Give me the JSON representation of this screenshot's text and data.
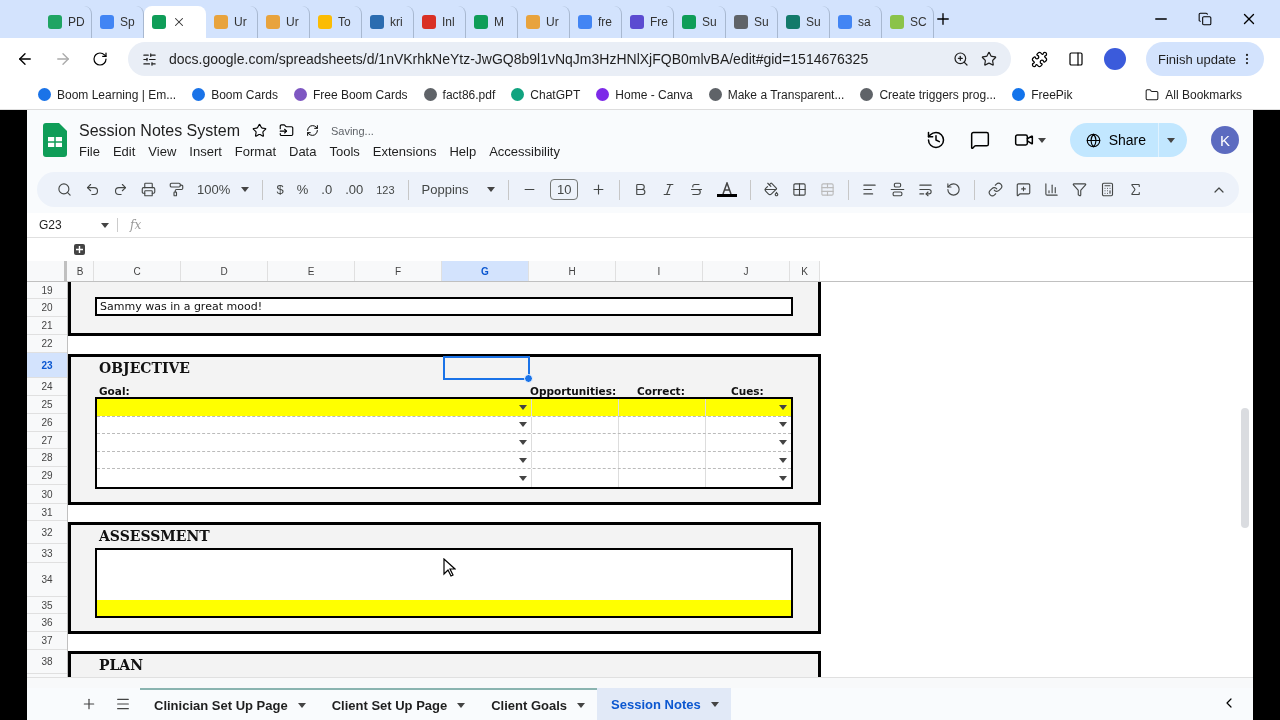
{
  "browser_tabs": [
    {
      "label": "PD",
      "color": "#1fa463",
      "selected": false
    },
    {
      "label": "Sp",
      "color": "#4285f4",
      "selected": false
    },
    {
      "color": "#0f9d58",
      "selected": true
    },
    {
      "label": "Ur",
      "color": "#e8a33d",
      "selected": false
    },
    {
      "label": "Ur",
      "color": "#e8a33d",
      "selected": false
    },
    {
      "label": "To",
      "color": "#fbbc04",
      "selected": false
    },
    {
      "label": "kri",
      "color": "#2b6cb0",
      "selected": false
    },
    {
      "label": "Inl",
      "color": "#d93025",
      "selected": false
    },
    {
      "label": "M",
      "color": "#0f9d58",
      "selected": false
    },
    {
      "label": "Ur",
      "color": "#e8a33d",
      "selected": false
    },
    {
      "label": "fre",
      "color": "#4285f4",
      "selected": false
    },
    {
      "label": "Fre",
      "color": "#5b4bd1",
      "selected": false
    },
    {
      "label": "Su",
      "color": "#0f9d58",
      "selected": false
    },
    {
      "label": "Su",
      "color": "#5f6368",
      "selected": false
    },
    {
      "label": "Su",
      "color": "#137a6b",
      "selected": false
    },
    {
      "label": "sa",
      "color": "#4285f4",
      "selected": false
    },
    {
      "label": "SC",
      "color": "#8bc34a",
      "selected": false
    }
  ],
  "address": {
    "url": "docs.google.com/spreadsheets/d/1nVKrhkNeYtz-JwGQ8b9l1vNqJm3HzHNlXjFQB0mlvBA/edit#gid=1514676325",
    "update_button": "Finish update"
  },
  "bookmarks": [
    {
      "label": "Boom Learning | Em...",
      "color": "#1a73e8"
    },
    {
      "label": "Boom Cards",
      "color": "#1a73e8"
    },
    {
      "label": "Free Boom Cards",
      "color": "#7e57c2"
    },
    {
      "label": "fact86.pdf",
      "color": "#5f6368"
    },
    {
      "label": "ChatGPT",
      "color": "#10a37f"
    },
    {
      "label": "Home - Canva",
      "color": "#7d2ae8"
    },
    {
      "label": "Make a Transparent...",
      "color": "#5f6368"
    },
    {
      "label": "Create triggers prog...",
      "color": "#5f6368"
    },
    {
      "label": "FreePik",
      "color": "#1273eb"
    }
  ],
  "all_bookmarks": "All Bookmarks",
  "document": {
    "title": "Session Notes System",
    "status": "Saving..."
  },
  "menu": [
    "File",
    "Edit",
    "View",
    "Insert",
    "Format",
    "Data",
    "Tools",
    "Extensions",
    "Help",
    "Accessibility"
  ],
  "share_button": "Share",
  "avatar": "K",
  "toolbar": {
    "zoom": "100%",
    "currency": "$",
    "percent": "%",
    "decrease_decimals": ".0",
    "increase_decimals": ".00",
    "number_format": "123",
    "font": "Poppins",
    "font_size": "10"
  },
  "name_box": "G23",
  "formula_label": "fx",
  "columns": [
    {
      "label": "B",
      "selected": false
    },
    {
      "label": "C",
      "selected": false
    },
    {
      "label": "D",
      "selected": false
    },
    {
      "label": "E",
      "selected": false
    },
    {
      "label": "F",
      "selected": false
    },
    {
      "label": "G",
      "selected": true
    },
    {
      "label": "H",
      "selected": false
    },
    {
      "label": "I",
      "selected": false
    },
    {
      "label": "J",
      "selected": false
    },
    {
      "label": "K",
      "selected": false
    }
  ],
  "rows": [
    {
      "label": "19",
      "selected": false
    },
    {
      "label": "20",
      "selected": false
    },
    {
      "label": "21",
      "selected": false
    },
    {
      "label": "22",
      "selected": false
    },
    {
      "label": "23",
      "selected": true
    },
    {
      "label": "24",
      "selected": false
    },
    {
      "label": "25",
      "selected": false
    },
    {
      "label": "26",
      "selected": false
    },
    {
      "label": "27",
      "selected": false
    },
    {
      "label": "28",
      "selected": false
    },
    {
      "label": "29",
      "selected": false
    },
    {
      "label": "30",
      "selected": false
    },
    {
      "label": "31",
      "selected": false
    },
    {
      "label": "32",
      "selected": false
    },
    {
      "label": "33",
      "selected": false
    },
    {
      "label": "34",
      "selected": false
    },
    {
      "label": "35",
      "selected": false
    },
    {
      "label": "36",
      "selected": false
    },
    {
      "label": "37",
      "selected": false
    },
    {
      "label": "38",
      "selected": false
    }
  ],
  "sections": [
    {
      "kind": "note",
      "text": "Sammy was in a great mood!"
    },
    {
      "kind": "goals",
      "title": "OBJECTIVE",
      "headers": [
        "Goal:",
        "Opportunities:",
        "Correct:",
        "Cues:"
      ],
      "lines": [
        {
          "highlighted": true
        },
        {
          "highlighted": false
        },
        {
          "highlighted": false
        },
        {
          "highlighted": false
        },
        {
          "highlighted": false
        }
      ]
    },
    {
      "kind": "textbox",
      "title": "ASSESSMENT",
      "lines": [
        {
          "highlighted": false
        },
        {
          "highlighted": true
        }
      ]
    },
    {
      "kind": "heading",
      "title": "PLAN"
    }
  ],
  "sheet_tabs": [
    {
      "label": "Clinician Set Up Page",
      "selected": false
    },
    {
      "label": "Client Set Up Page",
      "selected": false
    },
    {
      "label": "Client Goals",
      "selected": false
    },
    {
      "label": "Session Notes",
      "selected": true
    }
  ]
}
